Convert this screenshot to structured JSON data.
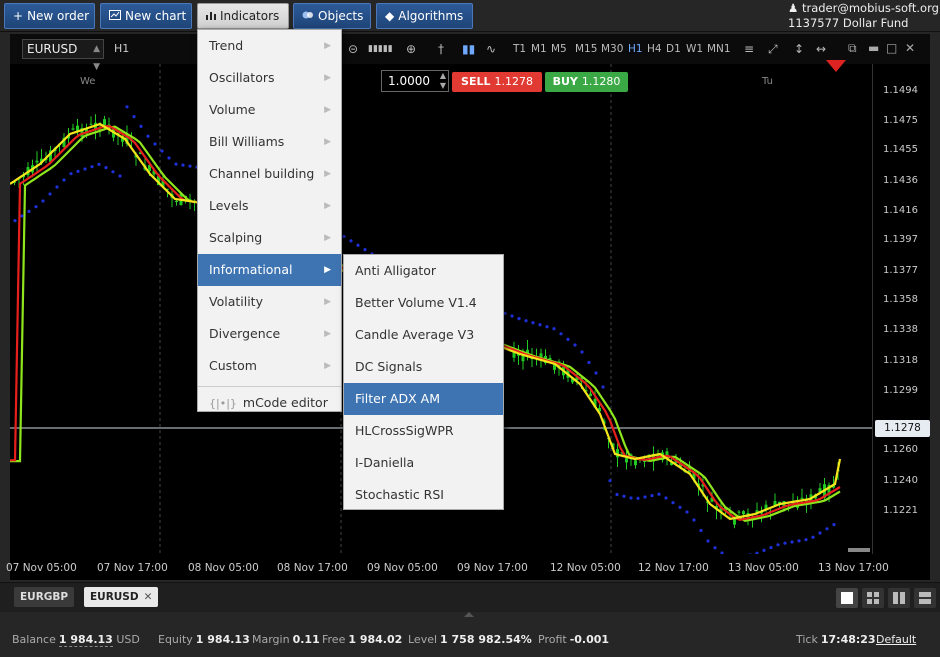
{
  "toolbar": {
    "new_order": "New order",
    "new_chart": "New chart",
    "indicators": "Indicators",
    "objects": "Objects",
    "algorithms": "Algorithms"
  },
  "account": {
    "user": "trader@mobius-soft.org",
    "number": "1137577",
    "fund": "Dollar Fund"
  },
  "chart": {
    "symbol": "EURUSD",
    "timeframe": "H1",
    "timeframes": [
      "T1",
      "M1",
      "M5",
      "M15",
      "M30",
      "H1",
      "H4",
      "D1",
      "W1",
      "MN1"
    ],
    "selected_timeframe": "H1",
    "quantity": "1.0000",
    "sell_label": "SELL",
    "sell_price": "1.1278",
    "buy_label": "BUY",
    "buy_price": "1.1280",
    "current_price": "1.1278",
    "day_markers": [
      "We",
      "Tu"
    ],
    "price_labels": [
      "1.1494",
      "1.1475",
      "1.1455",
      "1.1436",
      "1.1416",
      "1.1397",
      "1.1377",
      "1.1358",
      "1.1338",
      "1.1318",
      "1.1299",
      "1.1260",
      "1.1240",
      "1.1221"
    ],
    "time_labels": [
      "07 Nov 05:00",
      "07 Nov 17:00",
      "08 Nov 05:00",
      "08 Nov 17:00",
      "09 Nov 05:00",
      "09 Nov 17:00",
      "12 Nov 05:00",
      "12 Nov 17:00",
      "13 Nov 05:00",
      "13 Nov 17:00"
    ],
    "colors": {
      "up_candle": "#22cc22",
      "yellow_ma": "#f5e61c",
      "red_ma": "#e8201c",
      "green_ma": "#8fe61c",
      "dots": "#2030d8"
    }
  },
  "indicators_menu": [
    {
      "label": "Trend"
    },
    {
      "label": "Oscillators"
    },
    {
      "label": "Volume"
    },
    {
      "label": "Bill Williams"
    },
    {
      "label": "Channel building"
    },
    {
      "label": "Levels"
    },
    {
      "label": "Scalping"
    },
    {
      "label": "Informational"
    },
    {
      "label": "Volatility"
    },
    {
      "label": "Divergence"
    },
    {
      "label": "Custom"
    }
  ],
  "mcode_editor": "mCode editor",
  "informational_submenu": [
    {
      "label": "Anti Alligator"
    },
    {
      "label": "Better Volume V1.4"
    },
    {
      "label": "Candle Average V3"
    },
    {
      "label": "DC Signals"
    },
    {
      "label": "Filter ADX AM"
    },
    {
      "label": "HLCrossSigWPR"
    },
    {
      "label": "I-Daniella"
    },
    {
      "label": "Stochastic RSI"
    }
  ],
  "tabs": [
    {
      "label": "EURGBP"
    },
    {
      "label": "EURUSD"
    }
  ],
  "status": {
    "balance_label": "Balance",
    "balance_value": "1 984.13",
    "balance_currency": "USD",
    "equity_label": "Equity",
    "equity_value": "1 984.13",
    "margin_label": "Margin",
    "margin_value": "0.11",
    "free_label": "Free",
    "free_value": "1 984.02",
    "level_label": "Level",
    "level_value": "1 758 982.54%",
    "profit_label": "Profit",
    "profit_value": "-0.001",
    "tick_label": "Tick",
    "tick_value": "17:48:23",
    "default_label": "Default"
  }
}
